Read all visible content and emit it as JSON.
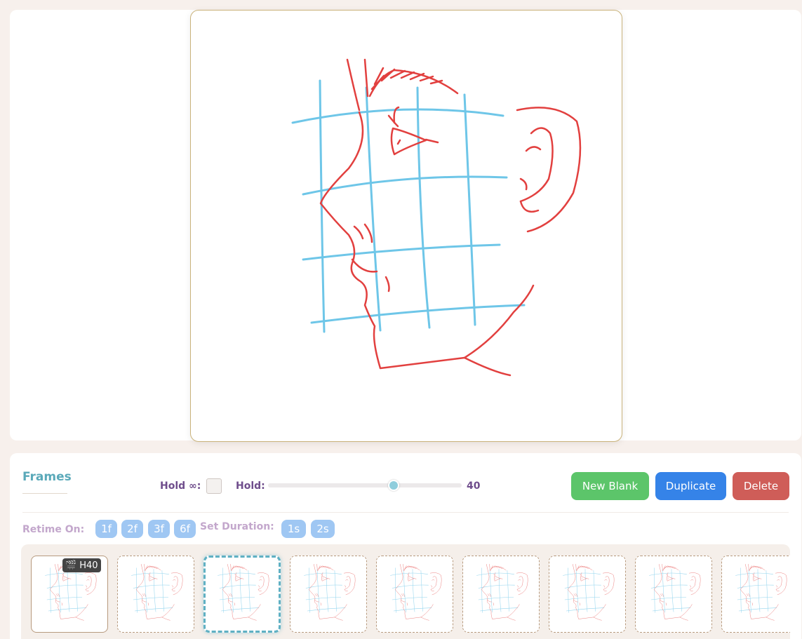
{
  "frames": {
    "title": "Frames",
    "hold_infinite_label": "Hold ∞:",
    "hold_infinite_checked": false,
    "hold_label": "Hold:",
    "hold_value": "40",
    "hold_slider_fraction": 0.65,
    "buttons": {
      "new_blank": "New Blank",
      "duplicate": "Duplicate",
      "delete": "Delete"
    },
    "retime_label": "Retime On:",
    "retime_options": [
      "1f",
      "2f",
      "3f",
      "6f"
    ],
    "set_duration_label": "Set Duration:",
    "duration_options": [
      "1s",
      "2s"
    ],
    "thumbnails": [
      {
        "badge_icon": "clapperboard-icon",
        "badge": "H40",
        "selected": false
      },
      {
        "badge": "",
        "selected": false
      },
      {
        "badge": "",
        "selected": true
      },
      {
        "badge": "",
        "selected": false
      },
      {
        "badge": "",
        "selected": false
      },
      {
        "badge": "",
        "selected": false
      },
      {
        "badge": "",
        "selected": false
      },
      {
        "badge": "",
        "selected": false
      },
      {
        "badge": "",
        "selected": false
      }
    ]
  },
  "colors": {
    "grid_stroke": "#6ec6e8",
    "sketch_stroke": "#e2403f",
    "accent_title": "#5aa9b9",
    "new_blank": "#5cc56a",
    "duplicate": "#3583e8",
    "delete": "#cf5d58",
    "chip": "#9fc7f3"
  }
}
